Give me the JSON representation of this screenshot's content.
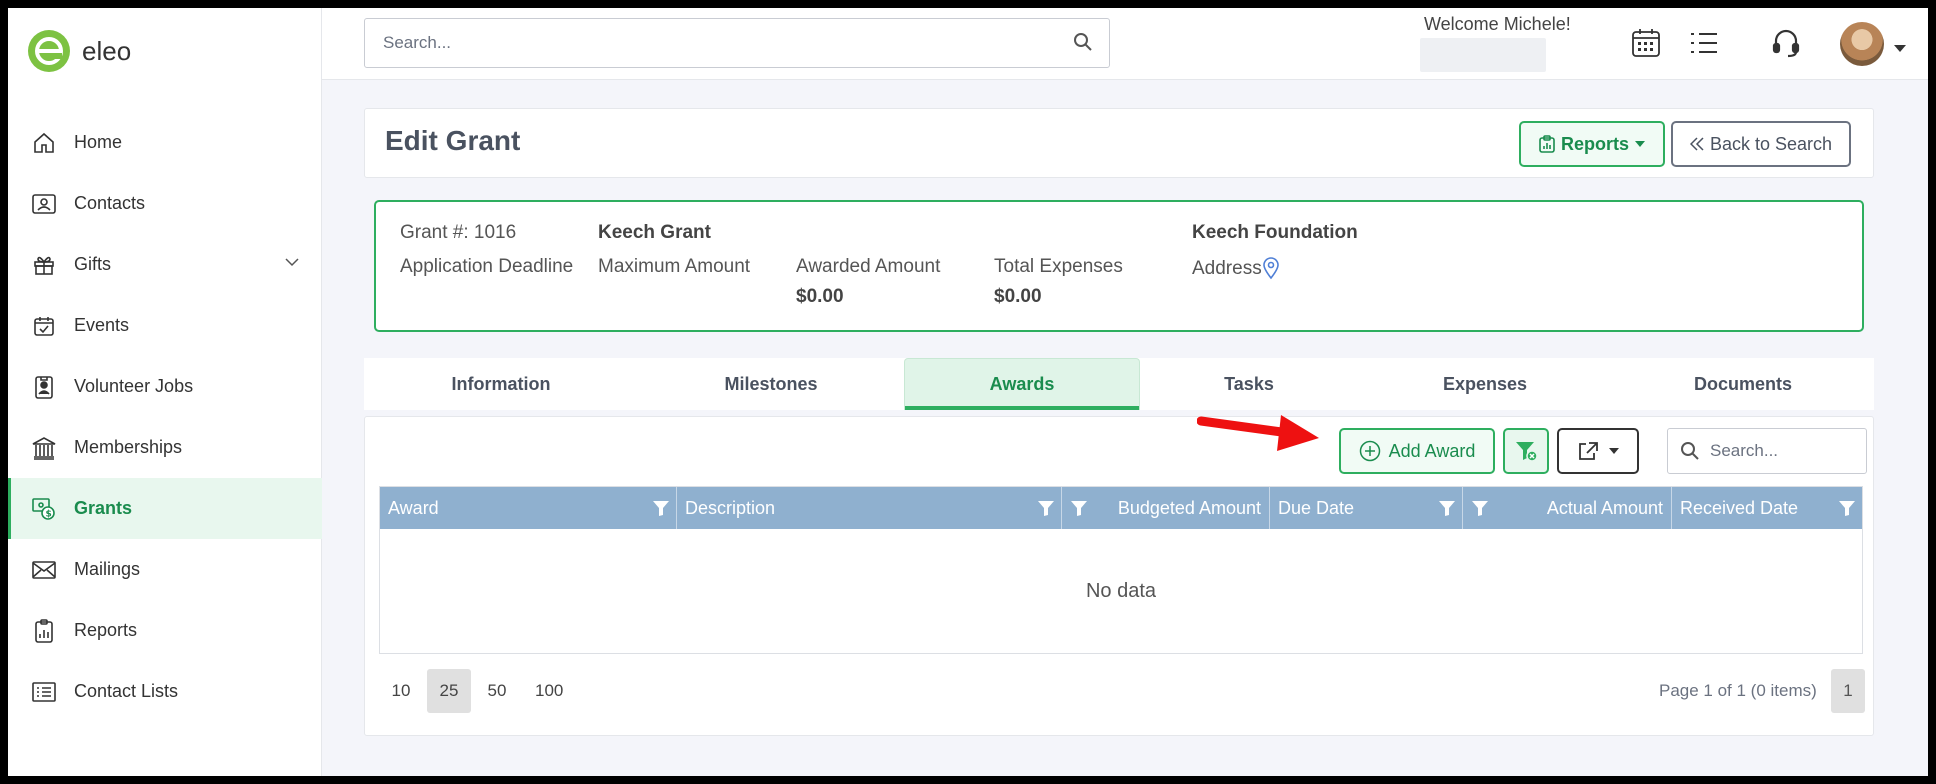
{
  "app": {
    "logo_text": "eleo",
    "brand_color": "#2eae5f",
    "logo_color": "#7dc242"
  },
  "sidebar": {
    "items": [
      {
        "label": "Home",
        "icon": "home-icon"
      },
      {
        "label": "Contacts",
        "icon": "contact-card-icon"
      },
      {
        "label": "Gifts",
        "icon": "gift-icon"
      },
      {
        "label": "Events",
        "icon": "calendar-check-icon"
      },
      {
        "label": "Volunteer Jobs",
        "icon": "badge-icon"
      },
      {
        "label": "Memberships",
        "icon": "bank-icon"
      },
      {
        "label": "Grants",
        "icon": "grant-money-icon"
      },
      {
        "label": "Mailings",
        "icon": "envelope-icon"
      },
      {
        "label": "Reports",
        "icon": "clipboard-chart-icon"
      },
      {
        "label": "Contact Lists",
        "icon": "list-icon"
      }
    ],
    "active": "Grants"
  },
  "header": {
    "search_placeholder": "Search...",
    "welcome": "Welcome Michele!"
  },
  "page": {
    "title": "Edit Grant",
    "reports_label": "Reports",
    "back_label": "Back to Search"
  },
  "grant": {
    "number_label": "Grant #: 1016",
    "application_deadline_label": "Application Deadline",
    "name": "Keech Grant",
    "maximum_amount_label": "Maximum Amount",
    "awarded_amount_label": "Awarded Amount",
    "awarded_amount": "$0.00",
    "total_expenses_label": "Total Expenses",
    "total_expenses": "$0.00",
    "foundation": "Keech Foundation",
    "address_label": "Address"
  },
  "tabs": [
    {
      "label": "Information"
    },
    {
      "label": "Milestones"
    },
    {
      "label": "Awards"
    },
    {
      "label": "Tasks"
    },
    {
      "label": "Expenses"
    },
    {
      "label": "Documents"
    }
  ],
  "active_tab": "Awards",
  "awards_grid": {
    "add_label": "Add Award",
    "search_placeholder": "Search...",
    "columns": [
      "Award",
      "Description",
      "Budgeted Amount",
      "Due Date",
      "Actual Amount",
      "Received Date"
    ],
    "empty_text": "No data",
    "page_sizes": [
      "10",
      "25",
      "50",
      "100"
    ],
    "selected_page_size": "25",
    "page_info": "Page 1 of 1 (0 items)",
    "current_page": "1"
  }
}
